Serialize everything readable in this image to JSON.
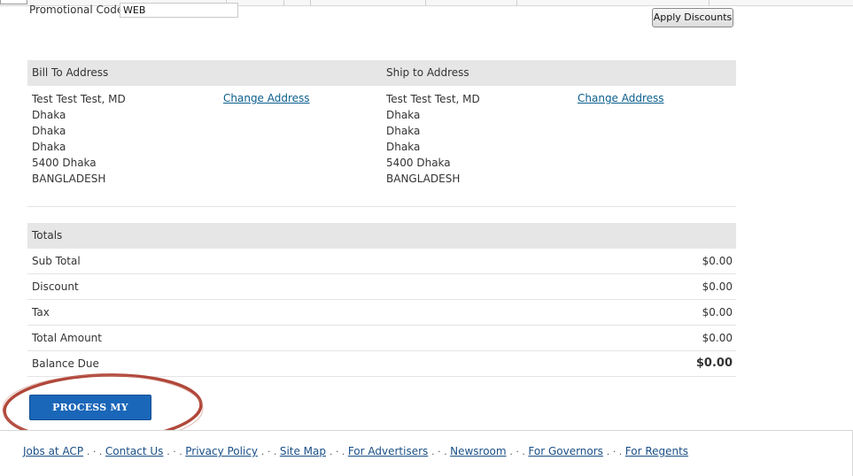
{
  "promo": {
    "label": "Promotional Code",
    "value": "WEB",
    "apply_label": "Apply Discounts"
  },
  "bill_to": {
    "header": "Bill To Address",
    "change_label": "Change Address",
    "lines": [
      "Test Test Test, MD",
      "Dhaka",
      "Dhaka",
      "Dhaka",
      "5400 Dhaka",
      "BANGLADESH"
    ]
  },
  "ship_to": {
    "header": "Ship to Address",
    "change_label": "Change Address",
    "lines": [
      "Test Test Test, MD",
      "Dhaka",
      "Dhaka",
      "Dhaka",
      "5400 Dhaka",
      "BANGLADESH"
    ]
  },
  "totals": {
    "header": "Totals",
    "rows": [
      {
        "label": "Sub Total",
        "value": "$0.00"
      },
      {
        "label": "Discount",
        "value": "$0.00"
      },
      {
        "label": "Tax",
        "value": "$0.00"
      },
      {
        "label": "Total Amount",
        "value": "$0.00"
      },
      {
        "label": "Balance Due",
        "value": "$0.00"
      }
    ]
  },
  "process_button": "PROCESS MY ORDER",
  "footer": {
    "separator": ". · . ",
    "links": [
      "Jobs at ACP",
      "Contact Us",
      "Privacy Policy",
      "Site Map",
      "For Advertisers",
      "Newsroom",
      "For Governors",
      "For Regents"
    ]
  },
  "colors": {
    "header_bg": "#e6e6e6",
    "link": "#0a5e8c",
    "primary_button": "#1a66b8",
    "highlight": "#b0473a"
  }
}
